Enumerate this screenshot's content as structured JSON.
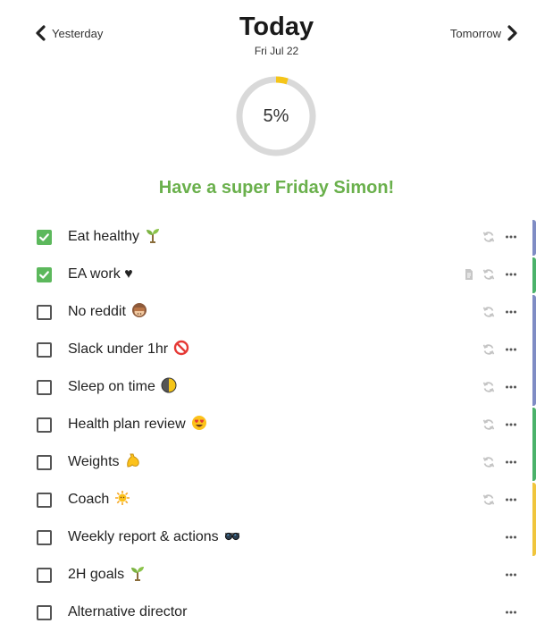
{
  "nav": {
    "prev_label": "Yesterday",
    "next_label": "Tomorrow",
    "prev_icon": "chevron-left-icon",
    "next_icon": "chevron-right-icon"
  },
  "header": {
    "title": "Today",
    "date": "Fri Jul 22"
  },
  "progress": {
    "value": 0.05,
    "label": "5%",
    "accent": "#f5c518",
    "track": "#d9d9d9"
  },
  "greeting": "Have a super Friday Simon!",
  "colors": {
    "check": "#5cb85c",
    "greeting": "#6ab04c",
    "tag_blue": "#7f8cc4",
    "tag_green": "#4bb26a",
    "tag_yellow": "#f0c53c"
  },
  "tasks": [
    {
      "label": "Eat healthy",
      "emoji": "seedling",
      "checked": true,
      "doc": false,
      "recurring": true,
      "tag": "blue"
    },
    {
      "label": "EA work ♥",
      "emoji": "",
      "checked": true,
      "doc": true,
      "recurring": true,
      "tag": "green"
    },
    {
      "label": "No reddit",
      "emoji": "see-no-evil-monkey",
      "checked": false,
      "doc": false,
      "recurring": true,
      "tag": "blue"
    },
    {
      "label": "Slack under 1hr",
      "emoji": "prohibited",
      "checked": false,
      "doc": false,
      "recurring": true,
      "tag": "blue"
    },
    {
      "label": "Sleep on time",
      "emoji": "moon",
      "checked": false,
      "doc": false,
      "recurring": true,
      "tag": "blue"
    },
    {
      "label": "Health plan review",
      "emoji": "heart-eyes",
      "checked": false,
      "doc": false,
      "recurring": true,
      "tag": "green"
    },
    {
      "label": "Weights",
      "emoji": "flexed-biceps",
      "checked": false,
      "doc": false,
      "recurring": true,
      "tag": "green"
    },
    {
      "label": "Coach",
      "emoji": "sun",
      "checked": false,
      "doc": false,
      "recurring": true,
      "tag": "yellow"
    },
    {
      "label": "Weekly report & actions",
      "emoji": "sunglasses",
      "checked": false,
      "doc": false,
      "recurring": false,
      "tag": "yellow"
    },
    {
      "label": "2H goals",
      "emoji": "seedling",
      "checked": false,
      "doc": false,
      "recurring": false,
      "tag": ""
    },
    {
      "label": "Alternative director",
      "emoji": "",
      "checked": false,
      "doc": false,
      "recurring": false,
      "tag": ""
    }
  ]
}
